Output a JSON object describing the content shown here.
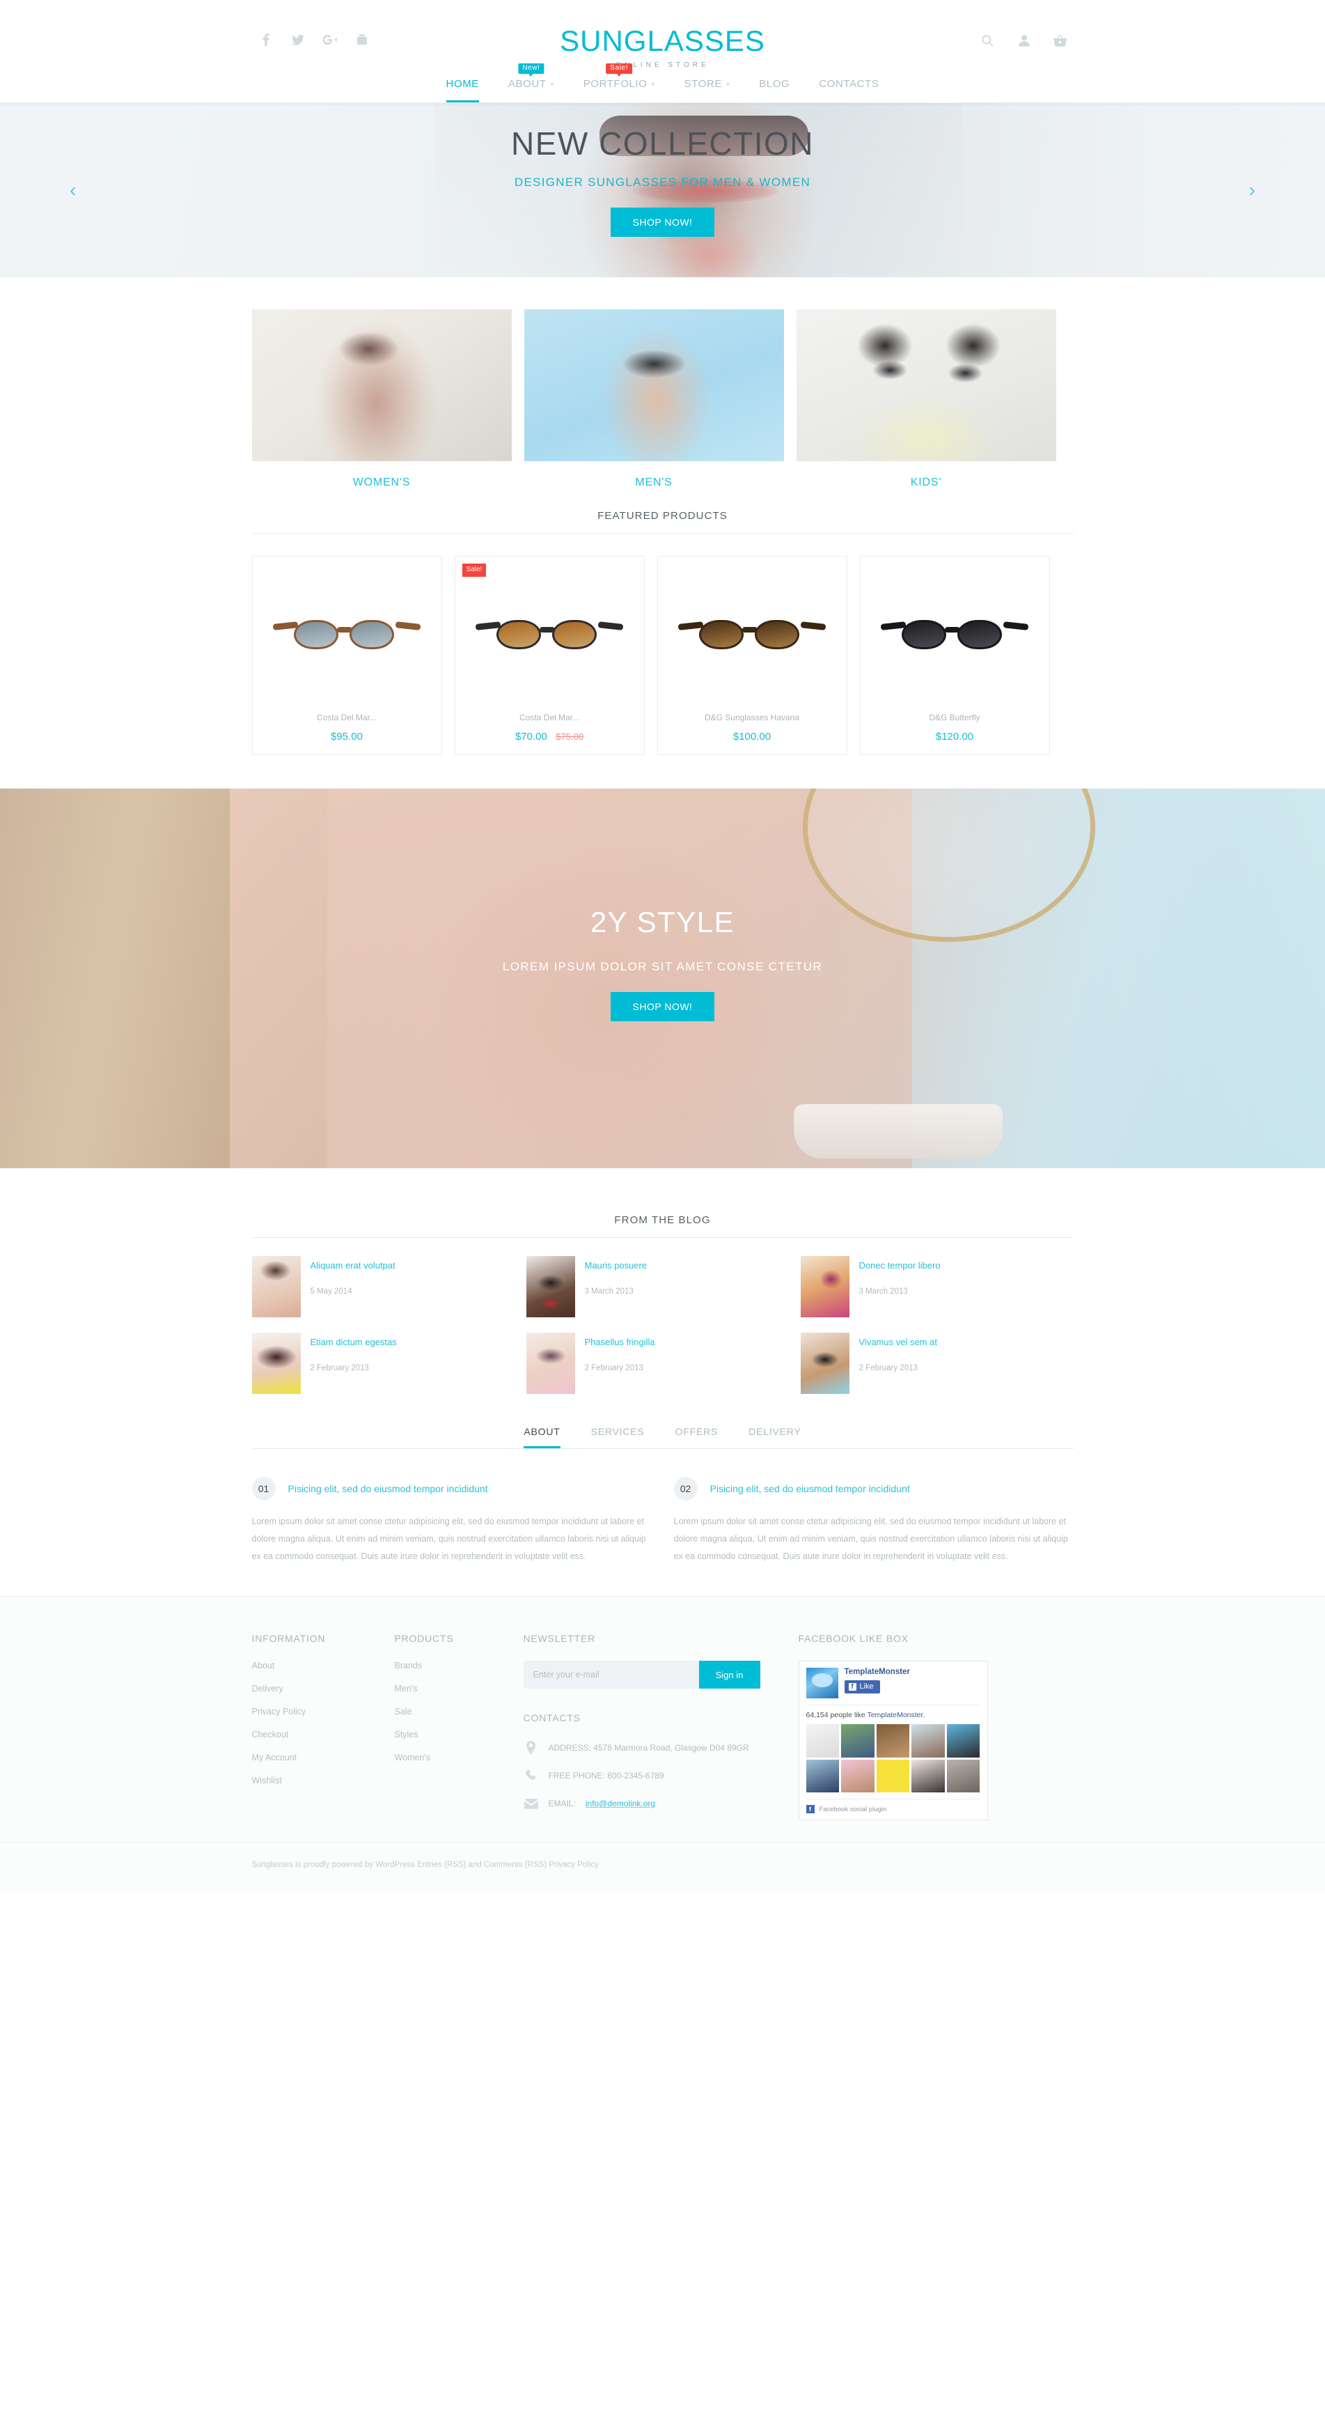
{
  "header": {
    "brand_title": "SUNGLASSES",
    "brand_subtitle": "ONLINE STORE",
    "socials": [
      {
        "name": "facebook-icon",
        "label": "f"
      },
      {
        "name": "twitter-icon",
        "label": "t"
      },
      {
        "name": "google-plus-icon",
        "label": "g+"
      },
      {
        "name": "youtube-icon",
        "label": "yt"
      }
    ],
    "tools": [
      {
        "name": "search-icon",
        "label": "Search"
      },
      {
        "name": "account-icon",
        "label": "Account"
      },
      {
        "name": "cart-icon",
        "label": "Cart"
      }
    ],
    "nav": [
      {
        "label": "HOME",
        "active": true,
        "caret": false,
        "badge": null
      },
      {
        "label": "ABOUT",
        "active": false,
        "caret": true,
        "badge": "New!",
        "badge_type": "new"
      },
      {
        "label": "PORTFOLIO",
        "active": false,
        "caret": true,
        "badge": "Sale!",
        "badge_type": "sale"
      },
      {
        "label": "STORE",
        "active": false,
        "caret": true,
        "badge": null
      },
      {
        "label": "BLOG",
        "active": false,
        "caret": false,
        "badge": null
      },
      {
        "label": "CONTACTS",
        "active": false,
        "caret": false,
        "badge": null
      }
    ]
  },
  "hero": {
    "title": "NEW COLLECTION",
    "subtitle": "DESIGNER SUNGLASSES FOR MEN & WOMEN",
    "button": "SHOP NOW!",
    "prev": "‹",
    "next": "›"
  },
  "categories": [
    {
      "label": "WOMEN'S",
      "img_class": "women"
    },
    {
      "label": "MEN'S",
      "img_class": "men"
    },
    {
      "label": "KIDS'",
      "img_class": "kids"
    }
  ],
  "featured": {
    "title": "FEATURED PRODUCTS",
    "products": [
      {
        "name": "Costa Del Mar...",
        "price": "$95.00",
        "old_price": null,
        "badge": null,
        "style": "p1"
      },
      {
        "name": "Costa Del Mar...",
        "price": "$70.00",
        "old_price": "$75.00",
        "badge": "Sale!",
        "style": "p2"
      },
      {
        "name": "D&G Sunglasses Havana",
        "price": "$100.00",
        "old_price": null,
        "badge": null,
        "style": "p3"
      },
      {
        "name": "D&G Butterfly",
        "price": "$120.00",
        "old_price": null,
        "badge": null,
        "style": "p4"
      }
    ]
  },
  "promo": {
    "title": "2Y STYLE",
    "subtitle": "LOREM IPSUM DOLOR SIT AMET CONSE CTETUR",
    "button": "SHOP NOW!"
  },
  "blog": {
    "title": "FROM THE BLOG",
    "posts": [
      {
        "title": "Aliquam erat volutpat",
        "date": "5 May 2014",
        "thumb": "bt1"
      },
      {
        "title": "Mauris posuere",
        "date": "3 March 2013",
        "thumb": "bt2"
      },
      {
        "title": "Donec tempor libero",
        "date": "3 March 2013",
        "thumb": "bt3"
      },
      {
        "title": "Etiam dictum egestas",
        "date": "2 February 2013",
        "thumb": "bt4"
      },
      {
        "title": "Phasellus fringilla",
        "date": "2 February 2013",
        "thumb": "bt5"
      },
      {
        "title": "Vivamus vel sem at",
        "date": "2 February 2013",
        "thumb": "bt6"
      }
    ]
  },
  "tabs": {
    "items": [
      {
        "label": "ABOUT",
        "active": true
      },
      {
        "label": "SERVICES",
        "active": false
      },
      {
        "label": "OFFERS",
        "active": false
      },
      {
        "label": "DELIVERY",
        "active": false
      }
    ],
    "columns": [
      {
        "num": "01",
        "heading": "Pisicing elit, sed do eiusmod tempor incididunt",
        "body": "Lorem ipsum dolor sit amet conse ctetur adipisicing elit, sed do eiusmod tempor incididunt ut labore et dolore magna aliqua. Ut enim ad minim veniam, quis nostrud exercitation ullamco laboris nisi ut aliquip ex ea commodo consequat. Duis aute irure dolor in reprehenderit in voluptate velit ess."
      },
      {
        "num": "02",
        "heading": "Pisicing elit, sed do eiusmod tempor incididunt",
        "body": "Lorem ipsum dolor sit amet conse ctetur adipisicing elit, sed do eiusmod tempor incididunt ut labore et dolore magna aliqua. Ut enim ad minim veniam, quis nostrud exercitation ullamco laboris nisi ut aliquip ex ea commodo consequat. Duis aute irure dolor in reprehenderit in voluptate velit ess."
      }
    ]
  },
  "footer": {
    "information": {
      "title": "INFORMATION",
      "links": [
        "About",
        "Delivery",
        "Privacy Policy",
        "Checkout",
        "My Account",
        "Wishlist"
      ]
    },
    "products": {
      "title": "PRODUCTS",
      "links": [
        "Brands",
        "Men's",
        "Sale",
        "Styles",
        "Women's"
      ]
    },
    "newsletter": {
      "title": "NEWSLETTER",
      "placeholder": "Enter your e-mail",
      "value": "",
      "button": "Sign in"
    },
    "contacts": {
      "title": "CONTACTS",
      "address": "ADDRESS: 4578 Marmora Road, Glasgow D04 89GR",
      "phone": "FREE PHONE: 800-2345-6789",
      "email_label": "EMAIL:",
      "email": "info@demolink.org"
    },
    "facebook": {
      "title": "FACEBOOK LIKE BOX",
      "page_name": "TemplateMonster",
      "like_button": "Like",
      "count_text": "64,154 people like ",
      "count_link": "TemplateMonster",
      "count_suffix": ".",
      "plugin_label": "Facebook social plugin"
    },
    "copyright": "Sunglasses is proudly powered by WordPress Entries (RSS) and Comments (RSS) Privacy Policy"
  },
  "colors": {
    "accent": "#00bcd4",
    "sale": "#f4453c",
    "muted": "#b0bec5"
  }
}
